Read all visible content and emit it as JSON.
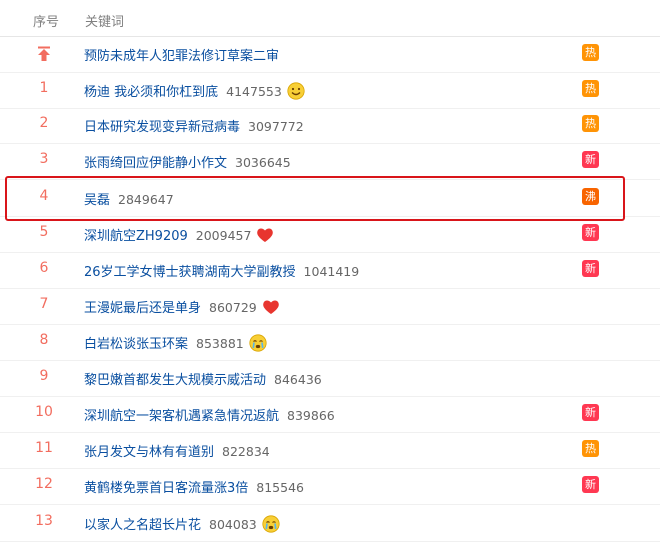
{
  "header": {
    "rank_label": "序号",
    "keyword_label": "关键词"
  },
  "colors": {
    "hot": "#ff9406",
    "new": "#ff3852",
    "boil": "#f86400",
    "rank": "#f26d5f",
    "link": "#0a4fa0",
    "highlight": "#d9151a"
  },
  "rows": [
    {
      "rank": "",
      "icon": "pinned-up-arrow-icon",
      "keyword": "预防未成年人犯罪法修订草案二审",
      "count": "",
      "emoji": "",
      "badge": "热",
      "badge_type": "hot"
    },
    {
      "rank": "1",
      "keyword": "杨迪 我必须和你杠到底",
      "count": "4147553",
      "emoji": "smile-emoji-icon",
      "badge": "热",
      "badge_type": "hot"
    },
    {
      "rank": "2",
      "keyword": "日本研究发现变异新冠病毒",
      "count": "3097772",
      "emoji": "",
      "badge": "热",
      "badge_type": "hot"
    },
    {
      "rank": "3",
      "keyword": "张雨绮回应伊能静小作文",
      "count": "3036645",
      "emoji": "",
      "badge": "新",
      "badge_type": "new"
    },
    {
      "rank": "4",
      "keyword": "吴磊",
      "count": "2849647",
      "emoji": "",
      "badge": "沸",
      "badge_type": "boil"
    },
    {
      "rank": "5",
      "keyword": "深圳航空ZH9209",
      "count": "2009457",
      "emoji": "heart-icon",
      "badge": "新",
      "badge_type": "new"
    },
    {
      "rank": "6",
      "keyword": "26岁工学女博士获聘湖南大学副教授",
      "count": "1041419",
      "emoji": "",
      "badge": "新",
      "badge_type": "new"
    },
    {
      "rank": "7",
      "keyword": "王漫妮最后还是单身",
      "count": "860729",
      "emoji": "heart-icon",
      "badge": "",
      "badge_type": ""
    },
    {
      "rank": "8",
      "keyword": "白岩松谈张玉环案",
      "count": "853881",
      "emoji": "crying-emoji-icon",
      "badge": "",
      "badge_type": ""
    },
    {
      "rank": "9",
      "keyword": "黎巴嫩首都发生大规模示威活动",
      "count": "846436",
      "emoji": "",
      "badge": "",
      "badge_type": ""
    },
    {
      "rank": "10",
      "keyword": "深圳航空一架客机遇紧急情况返航",
      "count": "839866",
      "emoji": "",
      "badge": "新",
      "badge_type": "new"
    },
    {
      "rank": "11",
      "keyword": "张月发文与林有有道别",
      "count": "822834",
      "emoji": "",
      "badge": "热",
      "badge_type": "hot"
    },
    {
      "rank": "12",
      "keyword": "黄鹤楼免票首日客流量涨3倍",
      "count": "815546",
      "emoji": "",
      "badge": "新",
      "badge_type": "new"
    },
    {
      "rank": "13",
      "keyword": "以家人之名超长片花",
      "count": "804083",
      "emoji": "crying-emoji-icon",
      "badge": "",
      "badge_type": ""
    }
  ]
}
